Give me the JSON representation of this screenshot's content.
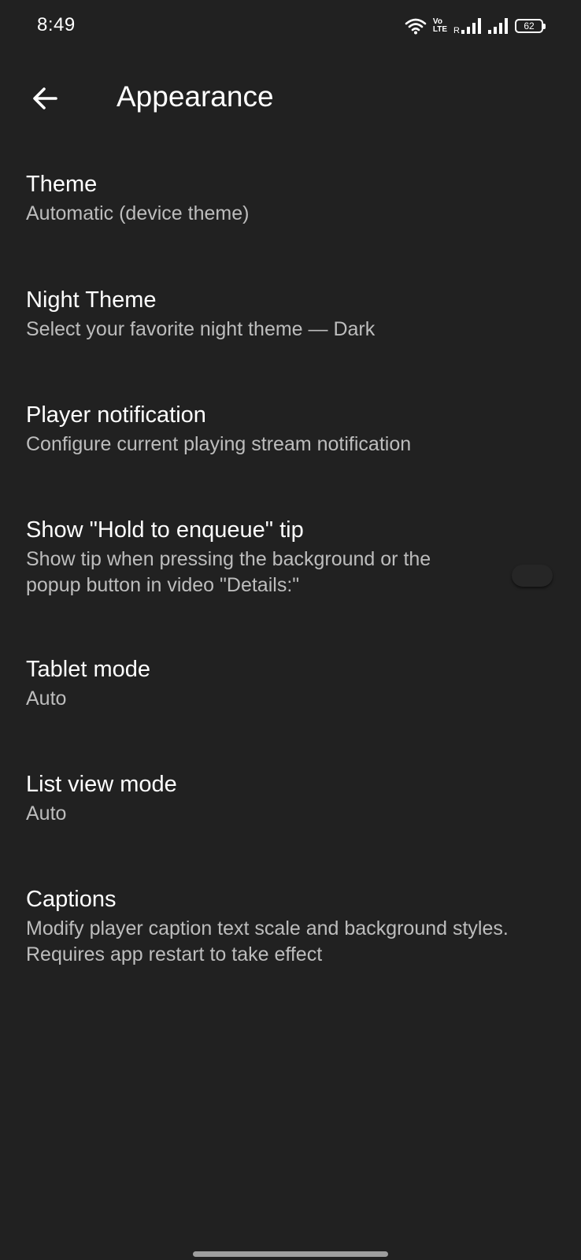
{
  "status_bar": {
    "time": "8:49",
    "volte_top": "Vo",
    "volte_bottom": "LTE",
    "roaming": "R",
    "battery": "62"
  },
  "app_bar": {
    "title": "Appearance",
    "back_icon": "arrow-left-icon"
  },
  "preferences": [
    {
      "title": "Theme",
      "summary": "Automatic (device theme)"
    },
    {
      "title": "Night Theme",
      "summary": "Select your favorite night theme — Dark"
    },
    {
      "title": "Player notification",
      "summary": "Configure current playing stream notification"
    },
    {
      "title": "Show \"Hold to enqueue\" tip",
      "summary": "Show tip when pressing the background or the popup button in video \"Details:\"",
      "toggle_on": false
    },
    {
      "title": "Tablet mode",
      "summary": "Auto"
    },
    {
      "title": "List view mode",
      "summary": "Auto"
    },
    {
      "title": "Captions",
      "summary": "Modify player caption text scale and background styles. Requires app restart to take effect"
    }
  ],
  "colors": {
    "background": "#212121",
    "text_primary": "#ffffff",
    "text_secondary": "#bdbdbd"
  }
}
